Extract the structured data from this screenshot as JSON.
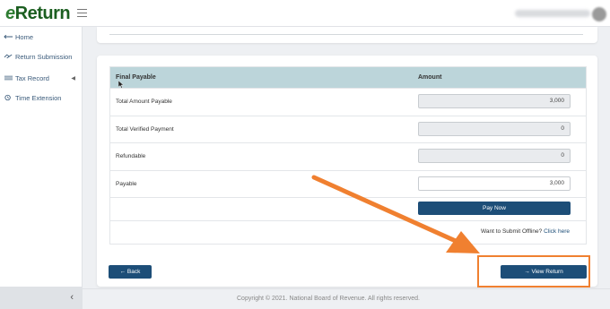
{
  "app": {
    "logo_e": "e",
    "logo_rest": "Return"
  },
  "sidebar": {
    "items": [
      {
        "label": "Home",
        "icon": "home-icon"
      },
      {
        "label": "Return Submission",
        "icon": "handshake-icon"
      },
      {
        "label": "Tax Record",
        "icon": "ledger-icon"
      },
      {
        "label": "Time Extension",
        "icon": "clock-icon"
      }
    ],
    "collapse_label": "‹"
  },
  "table": {
    "headers": {
      "label": "Final Payable",
      "amount": "Amount"
    },
    "rows": [
      {
        "label": "Total Amount Payable",
        "value": "3,000"
      },
      {
        "label": "Total Verified Payment",
        "value": "0"
      },
      {
        "label": "Refundable",
        "value": "0"
      },
      {
        "label": "Payable",
        "value": "3,000"
      }
    ],
    "pay_now_label": "Pay Now",
    "offline_text": "Want to Submit Offline?",
    "offline_link": "Click here"
  },
  "actions": {
    "back_label": "← Back",
    "view_return_label": "→ View Return"
  },
  "footer": {
    "copyright": "Copyright © 2021. National Board of Revenue. All rights reserved."
  },
  "colors": {
    "primary": "#1d4e78",
    "table_header": "#bcd5da",
    "annotation": "#f08030",
    "brand_green": "#2e7d32"
  }
}
